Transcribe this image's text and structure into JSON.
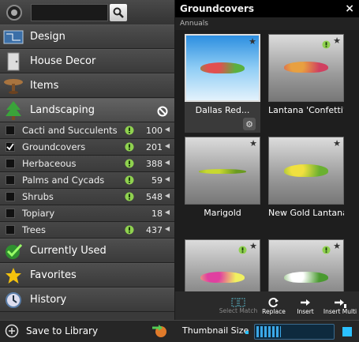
{
  "search": {
    "placeholder": "",
    "value": ""
  },
  "categories": [
    {
      "label": "Design",
      "icon": "blueprint-icon"
    },
    {
      "label": "House Decor",
      "icon": "door-icon"
    },
    {
      "label": "Items",
      "icon": "table-icon"
    },
    {
      "label": "Landscaping",
      "icon": "tree-icon"
    }
  ],
  "subcategories": [
    {
      "label": "Cacti and Succulents",
      "count": "100",
      "checked": false,
      "alert": true
    },
    {
      "label": "Groundcovers",
      "count": "201",
      "checked": true,
      "alert": true
    },
    {
      "label": "Herbaceous",
      "count": "388",
      "checked": false,
      "alert": true
    },
    {
      "label": "Palms and Cycads",
      "count": "59",
      "checked": false,
      "alert": true
    },
    {
      "label": "Shrubs",
      "count": "548",
      "checked": false,
      "alert": true
    },
    {
      "label": "Topiary",
      "count": "18",
      "checked": false,
      "alert": false
    },
    {
      "label": "Trees",
      "count": "437",
      "checked": false,
      "alert": true
    }
  ],
  "bottom_categories": [
    {
      "label": "Currently Used",
      "icon": "checkmark-icon"
    },
    {
      "label": "Favorites",
      "icon": "star-icon"
    },
    {
      "label": "History",
      "icon": "clock-icon"
    }
  ],
  "panel": {
    "title": "Groundcovers",
    "close": "×",
    "section": "Annuals"
  },
  "tiles": [
    {
      "label": "Dallas Red...",
      "selected": true
    },
    {
      "label": "Lantana 'Confetti'",
      "selected": false
    },
    {
      "label": "Marigold",
      "selected": false
    },
    {
      "label": "New Gold Lantana",
      "selected": false
    },
    {
      "label": "",
      "selected": false
    },
    {
      "label": "",
      "selected": false
    }
  ],
  "toolbar": {
    "select_match": "Select Match",
    "replace": "Replace",
    "insert": "Insert",
    "insert_multi": "Insert Multi"
  },
  "footer": {
    "save_label": "Save to Library",
    "thumb_label": "Thumbnail Size",
    "thumb_level": 0.32
  },
  "colors": {
    "accent": "#2bc0ff",
    "alert": "#8fd14f"
  }
}
